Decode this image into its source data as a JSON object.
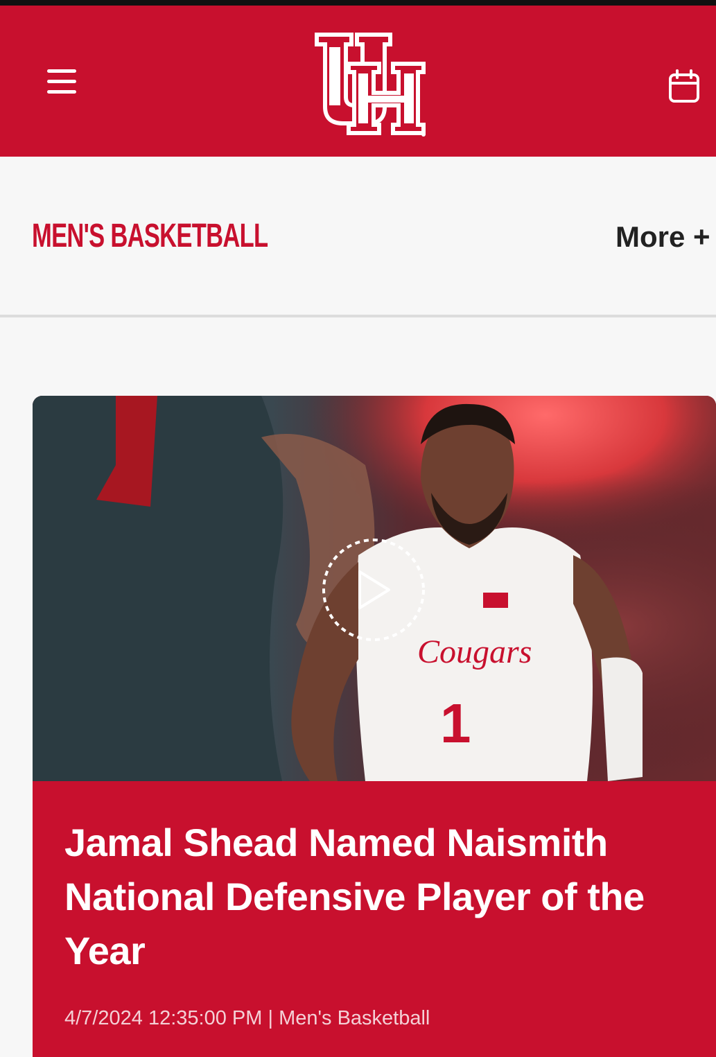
{
  "header": {
    "menu_icon": "hamburger-menu-icon",
    "logo_text": "UH",
    "calendar_icon": "calendar-icon",
    "brand_color": "#c8102e"
  },
  "subnav": {
    "section_title": "MEN'S BASKETBALL",
    "more_label": "More +"
  },
  "featured_story": {
    "image_description_icon": "play-video-icon",
    "title": "Jamal Shead Named Naismith National Defensive Player of the Year",
    "date": "4/7/2024 12:35:00 PM",
    "separator": "|",
    "category": "Men's Basketball",
    "jersey_number": "1",
    "jersey_text": "Cougars"
  }
}
